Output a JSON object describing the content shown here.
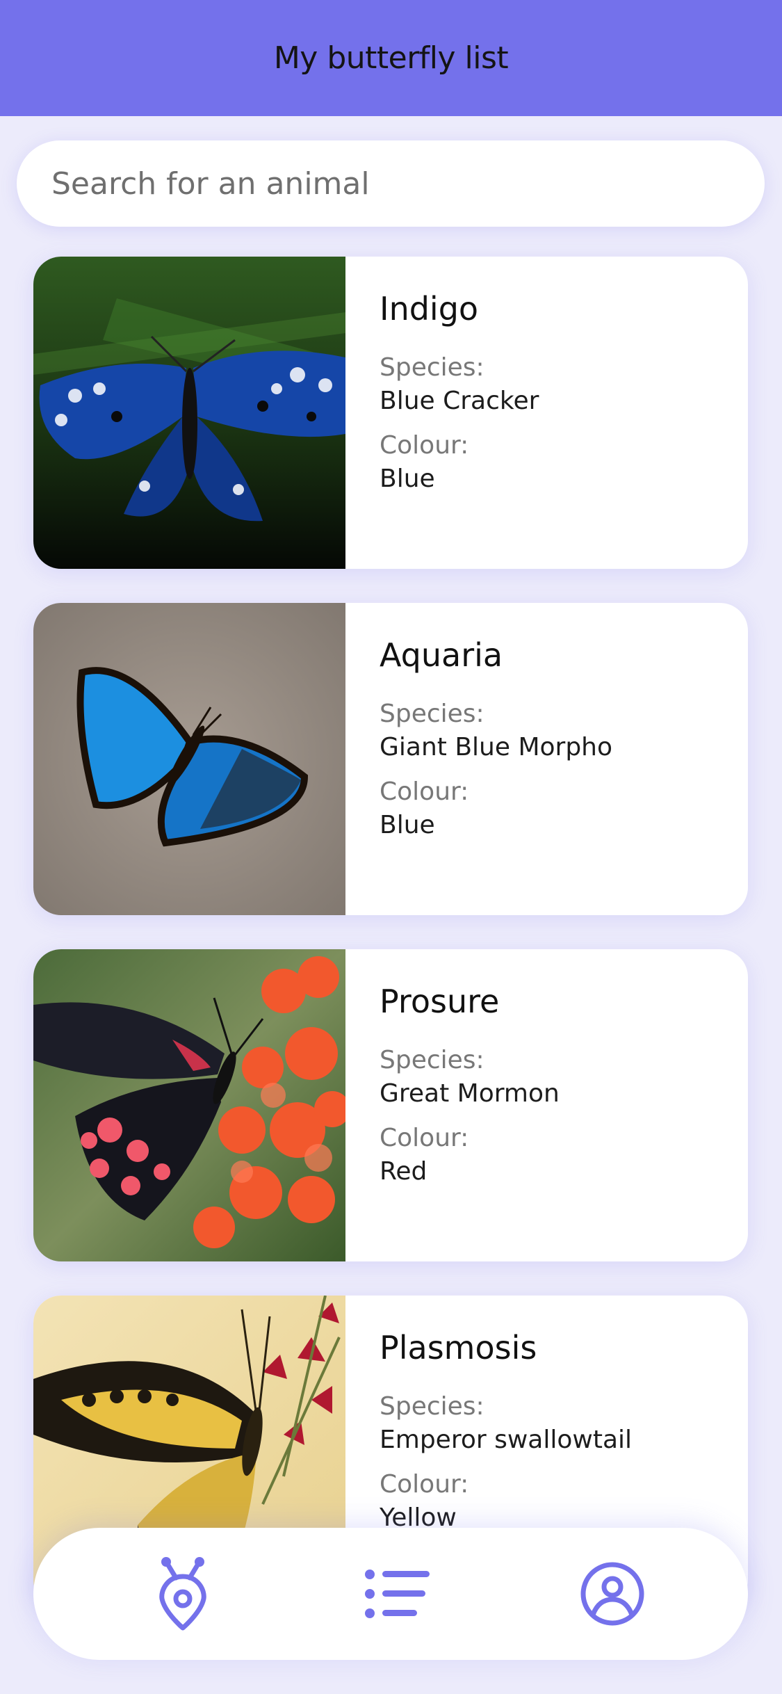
{
  "header": {
    "title": "My butterfly list"
  },
  "search": {
    "placeholder": "Search for an animal",
    "value": ""
  },
  "labels": {
    "species": "Species:",
    "colour": "Colour:"
  },
  "cards": [
    {
      "name": "Indigo",
      "species": "Blue Cracker",
      "colour": "Blue"
    },
    {
      "name": "Aquaria",
      "species": "Giant Blue Morpho",
      "colour": "Blue"
    },
    {
      "name": "Prosure",
      "species": "Great Mormon",
      "colour": "Red"
    },
    {
      "name": "Plasmosis",
      "species": "Emperor swallowtail",
      "colour": "Yellow"
    }
  ],
  "tabbar": {
    "items": [
      {
        "icon": "bug-location-icon"
      },
      {
        "icon": "list-icon"
      },
      {
        "icon": "user-profile-icon"
      }
    ]
  },
  "colors": {
    "accent": "#7471eb",
    "background": "#ecebfb"
  }
}
